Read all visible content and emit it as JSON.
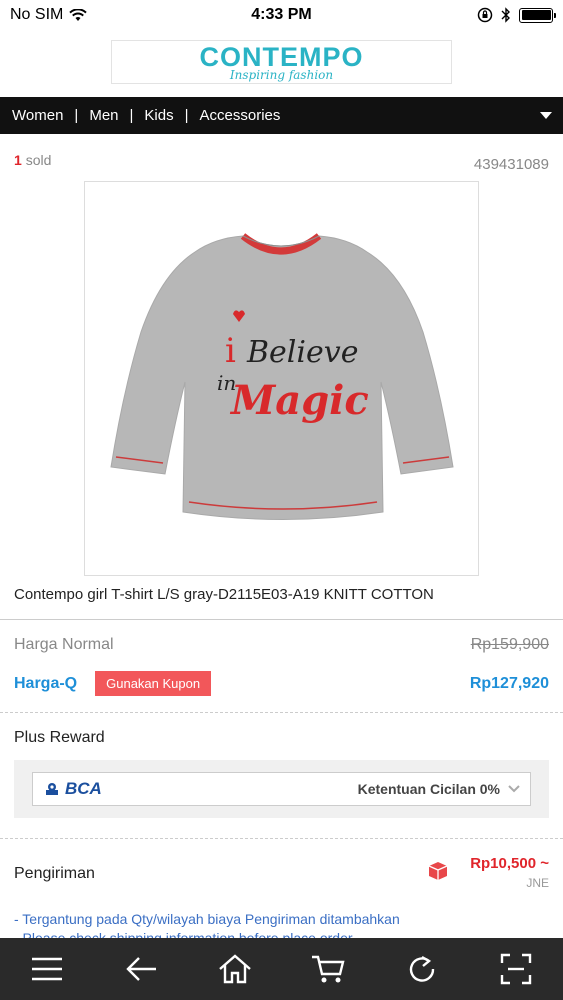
{
  "status_bar": {
    "carrier": "No SIM",
    "time": "4:33 PM",
    "battery_level": 1.0
  },
  "brand": {
    "name": "CONTEMPO",
    "tagline": "Inspiring fashion"
  },
  "nav": {
    "items": [
      "Women",
      "Men",
      "Kids",
      "Accessories"
    ]
  },
  "product": {
    "sold_count": "1",
    "sold_label": "sold",
    "sku": "439431089",
    "shirt_text_1": "i Believe",
    "shirt_text_2": "in",
    "shirt_text_3": "Magic",
    "title": "Contempo girl T-shirt L/S gray-D2115E03-A19 KNITT COTTON"
  },
  "pricing": {
    "normal_label": "Harga Normal",
    "normal_price": "Rp159,900",
    "q_label": "Harga-Q",
    "coupon_button": "Gunakan Kupon",
    "q_price": "Rp127,920"
  },
  "reward": {
    "label": "Plus Reward",
    "bank": "BCA",
    "installment": "Ketentuan Cicilan 0%"
  },
  "shipping": {
    "label": "Pengiriman",
    "price": "Rp10,500 ~",
    "courier": "JNE",
    "note1": "- Tergantung pada Qty/wilayah biaya Pengiriman ditambahkan",
    "note2": "- Please check shipping information before place order"
  },
  "colors": {
    "accent_blue": "#1e8fd8",
    "accent_red": "#e0252b",
    "brand_teal": "#2ab3c5",
    "nav_bg": "#111111",
    "toolbar_bg": "#2a2a2a"
  },
  "toolbar_icons": [
    "menu-icon",
    "back-arrow-icon",
    "home-icon",
    "cart-icon",
    "refresh-icon",
    "fullscreen-icon"
  ]
}
